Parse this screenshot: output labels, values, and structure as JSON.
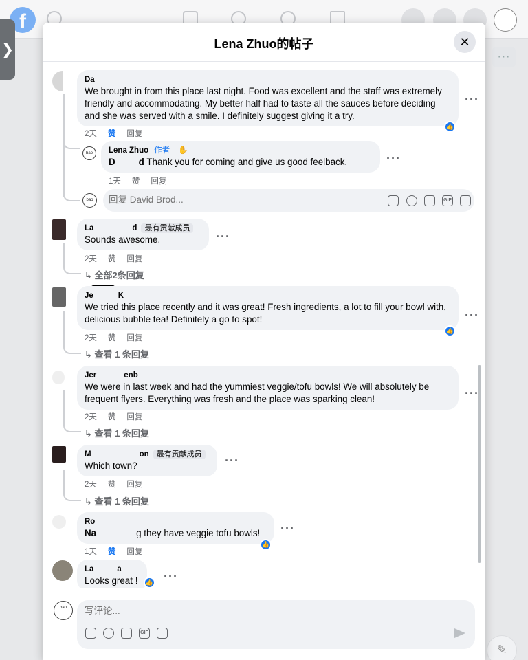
{
  "background": {
    "logo": "f",
    "right_button": "···",
    "left_tab": "❯"
  },
  "modal": {
    "title": "Lena Zhuo的帖子",
    "close": "✕"
  },
  "comments": [
    {
      "author": "Da",
      "text": "We brought in from this place last night. Food was excellent and the staff was extremely friendly and accommodating. My better half had to taste all the sauces before deciding and she was served with a smile. I definitely suggest giving it a try.",
      "time": "2天",
      "like": "赞",
      "reply": "回复"
    },
    {
      "author": "Lena Zhuo",
      "author_tag": "作者",
      "text_mention": "D",
      "text_mention_tail": "d",
      "text": " Thank you for coming and give us good feelback.",
      "time": "1天",
      "like": "赞",
      "reply": "回复"
    },
    {
      "author": "La",
      "author_tail": "d",
      "badge": "最有贡献成员",
      "text": "Sounds awesome.",
      "time": "2天",
      "like": "赞",
      "reply": "回复",
      "replies": "全部2条回复"
    },
    {
      "author": "Je",
      "author_tail": "K",
      "text": "We tried this place recently and it was great! Fresh ingredients, a lot to fill your bowl with, delicious bubble tea! Definitely a go to spot!",
      "time": "2天",
      "like": "赞",
      "reply": "回复",
      "replies": "查看 1 条回复"
    },
    {
      "author": "Jer",
      "author_tail": "enb",
      "text": "We were in last week and had the yummiest veggie/tofu bowls! We will absolutely be frequent flyers. Everything was fresh and the place was sparking clean!",
      "time": "2天",
      "like": "赞",
      "reply": "回复",
      "replies": "查看 1 条回复"
    },
    {
      "author": "M",
      "author_tail": "on",
      "badge": "最有贡献成员",
      "text": "Which town?",
      "time": "2天",
      "like": "赞",
      "reply": "回复",
      "replies": "查看 1 条回复"
    },
    {
      "author": "Ro",
      "text_head": "Na",
      "text": "g they have veggie tofu bowls!",
      "time": "1天",
      "like": "赞",
      "reply": "回复"
    },
    {
      "author": "La",
      "author_tail": "a",
      "text": "Looks great !"
    }
  ],
  "reply_input": {
    "placeholder": "回复 David Brod..."
  },
  "comment_input": {
    "placeholder": "写评论..."
  },
  "tools": {
    "sticker": "☺",
    "gif": "GIF"
  },
  "accent_color": "#1877f2",
  "reaction": "👍"
}
